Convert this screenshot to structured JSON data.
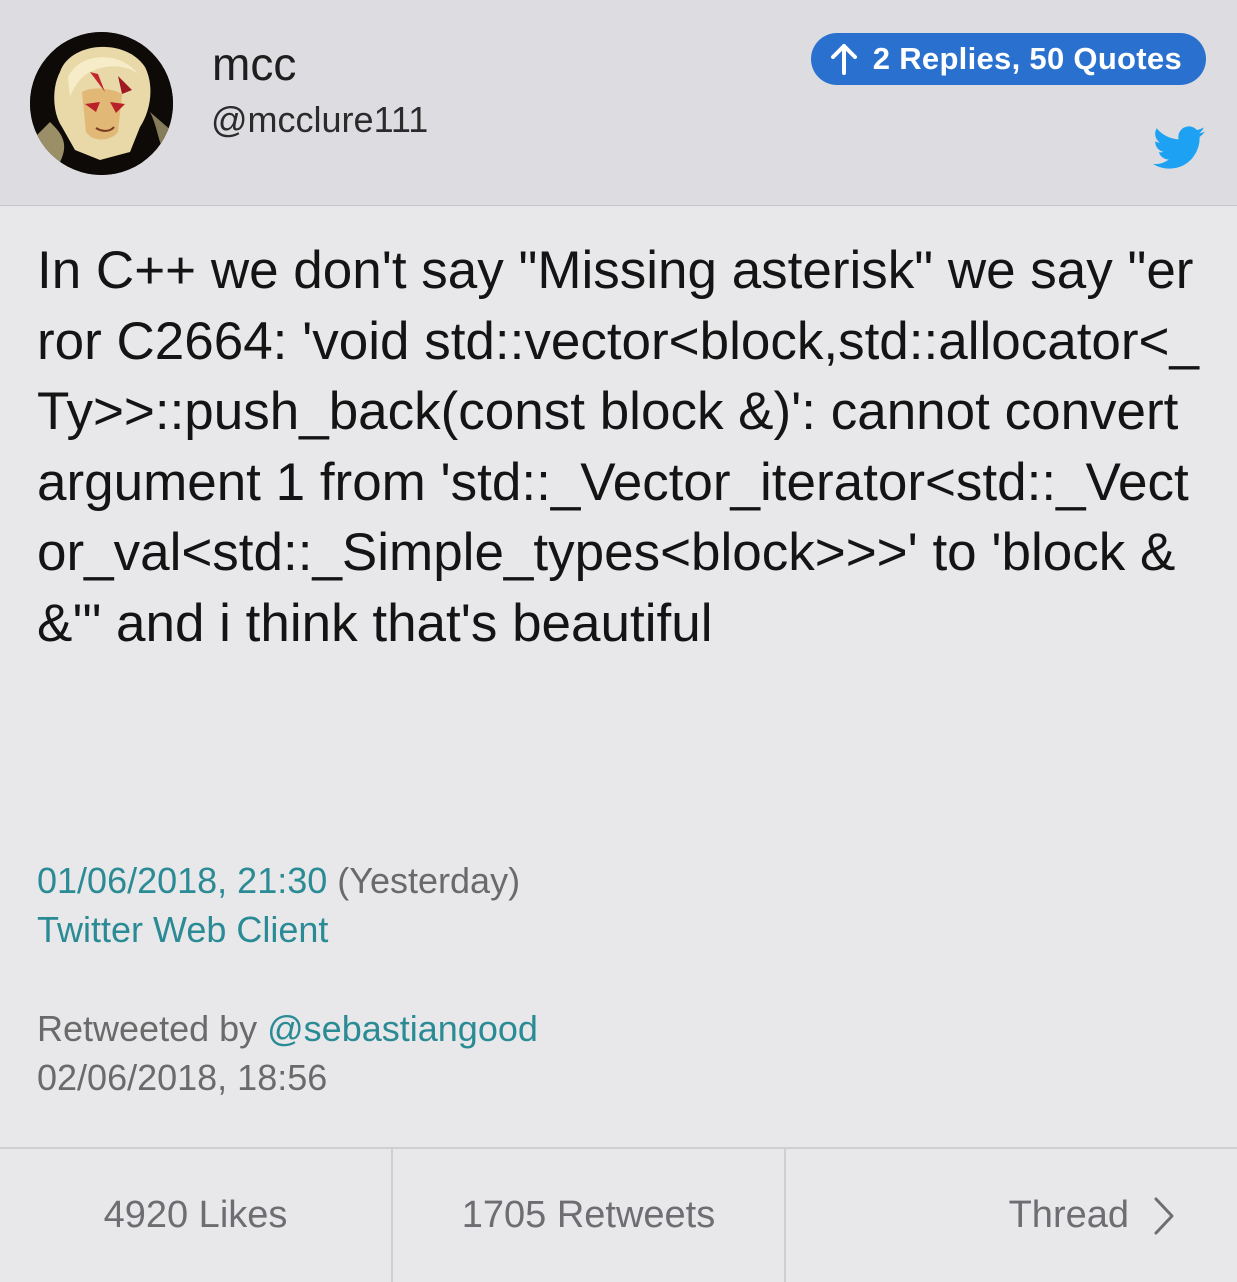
{
  "header": {
    "display_name": "mcc",
    "handle": "@mcclure111",
    "replies_label": "2 Replies, 50 Quotes",
    "accent_color": "#2a71cf",
    "twitter_color": "#1da1f2",
    "avatar_icon": "anime-character-avatar",
    "reply_arrow_icon": "arrow-up-icon",
    "bird_icon": "twitter-bird-icon"
  },
  "tweet": {
    "text": "In C++ we don't say \"Missing asterisk\" we say \"error C2664: 'void std::vector<block,std::allocator<_Ty>>::push_back(const block &)': cannot convert argument 1 from 'std::_Vector_iterator<std::_Vector_val<std::_Simple_types<block>>>' to 'block &&'\" and i think that's beautiful",
    "date": "01/06/2018, 21:30",
    "relative": "(Yesterday)",
    "client": "Twitter Web Client",
    "link_color": "#2a8b95"
  },
  "retweet": {
    "prefix": "Retweeted by ",
    "user": "@sebastiangood",
    "date": "02/06/2018, 18:56"
  },
  "footer": {
    "likes": "4920 Likes",
    "retweets": "1705 Retweets",
    "thread": "Thread"
  }
}
